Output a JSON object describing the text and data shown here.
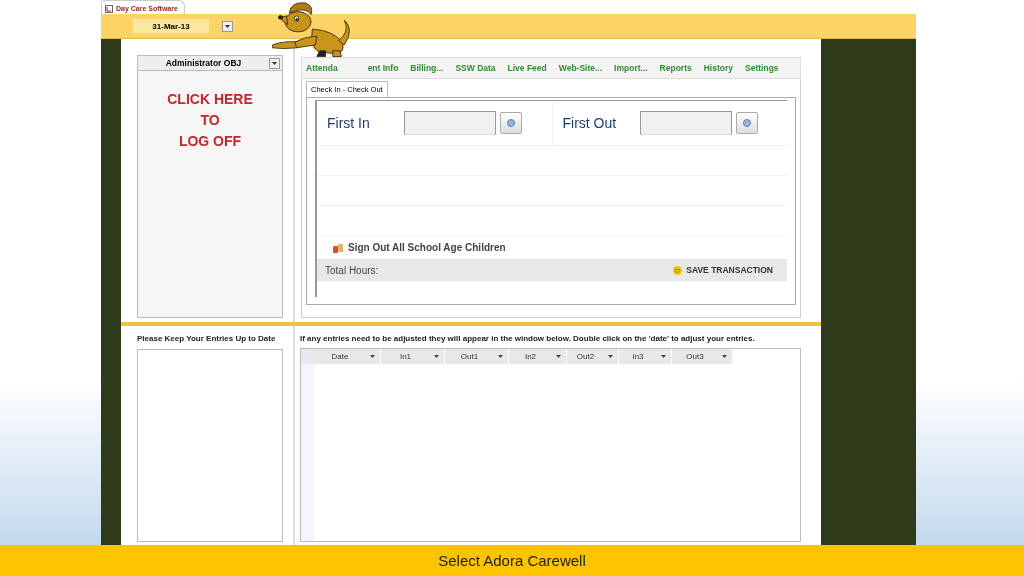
{
  "app_tab": {
    "title": "Day Care Software"
  },
  "date_picker": {
    "value": "31-Mar-13"
  },
  "user_select": {
    "value": "Administrator OBJ"
  },
  "logoff": {
    "lines": [
      "CLICK HERE",
      "TO",
      "LOG OFF"
    ]
  },
  "nav_tabs": [
    {
      "label": "Attenda"
    },
    {
      "label": "ent Info"
    },
    {
      "label": "Billing..."
    },
    {
      "label": "SSW Data"
    },
    {
      "label": "Live Feed"
    },
    {
      "label": "Web-Site..."
    },
    {
      "label": "Import..."
    },
    {
      "label": "Reports"
    },
    {
      "label": "History"
    },
    {
      "label": "Settings"
    }
  ],
  "sub_tabs": [
    {
      "label": "Check In - Check Out",
      "selected": true
    }
  ],
  "check_in": {
    "first_in_label": "First In",
    "first_out_label": "First Out"
  },
  "sign_out_all": "Sign Out All School Age Children",
  "total_hours_label": "Total Hours:",
  "save_button": "SAVE TRANSACTION",
  "reminder": "Please Keep Your Entries Up to Date",
  "adjust_note": "If any entries need to be adjusted they will appear in the window below. Double click on the 'date' to adjust your entries.",
  "table": {
    "columns": [
      "Date",
      "In1",
      "Out1",
      "In2",
      "Out2",
      "In3",
      "Out3"
    ]
  },
  "caption": "Select Adora Carewell"
}
